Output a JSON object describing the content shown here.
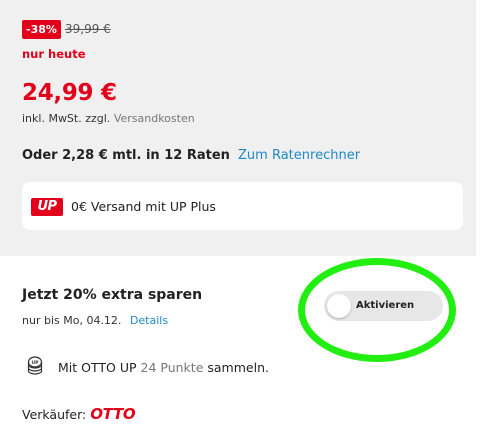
{
  "pricing": {
    "discount_badge": "-38%",
    "old_price": "39,99 €",
    "today_label": "nur heute",
    "current_price": "24,99 €",
    "vat_text": "inkl. MwSt. zzgl.",
    "shipping_link": "Versandkosten",
    "installment_text": "Oder 2,28 € mtl. in 12 Raten",
    "calculator_link": "Zum Ratenrechner"
  },
  "up_card": {
    "logo_text": "UP",
    "text": "0€ Versand mit UP Plus"
  },
  "extra_saving": {
    "title": "Jetzt 20% extra sparen",
    "validity": "nur bis Mo, 04.12.",
    "details_link": "Details",
    "toggle_label": "Aktivieren",
    "toggle_on": false
  },
  "points": {
    "icon": "coin-stack-icon",
    "prefix": "Mit OTTO UP",
    "count": "24 Punkte",
    "suffix": "sammeln."
  },
  "seller": {
    "label": "Verkäufer:",
    "name": "OTTO"
  },
  "colors": {
    "accent_red": "#e3001b",
    "link_blue": "#1e88c7",
    "highlight_green": "#22ee11",
    "panel_gray": "#f0f0f0"
  }
}
